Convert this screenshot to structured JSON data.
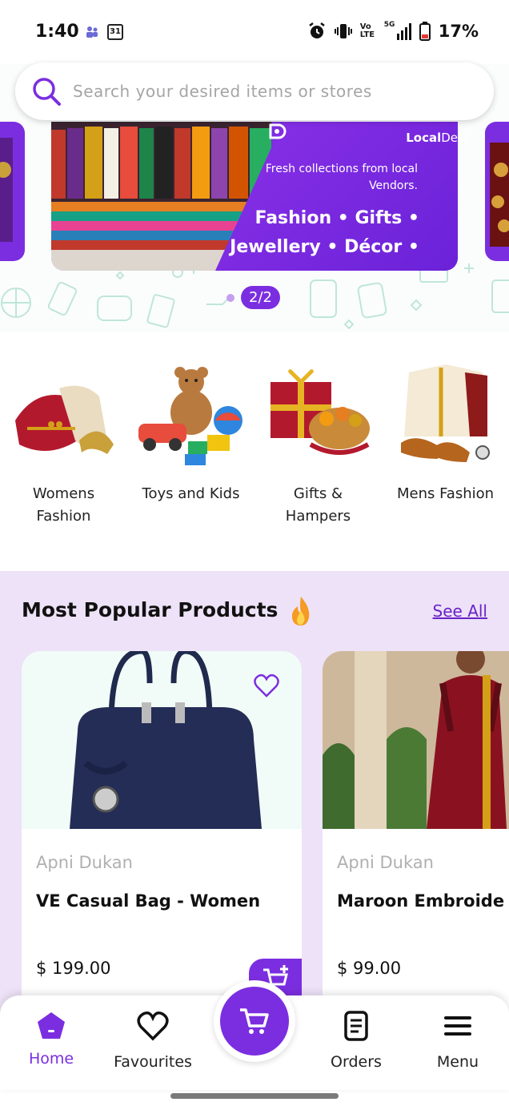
{
  "status_bar": {
    "time": "1:40",
    "calendar_day": "31",
    "battery": "17%",
    "volte": "Vo LTE",
    "network": "5G"
  },
  "search": {
    "placeholder": "Search your desired items or stores"
  },
  "banner": {
    "brand_bold": "Local",
    "brand_thin": "Desi",
    "subtitle": "Fresh collections from local Vendors.",
    "headline": "Fashion • Gifts • Jewellery • Décor •",
    "pager": "2/2"
  },
  "categories": [
    {
      "label": "Womens Fashion"
    },
    {
      "label": "Toys and Kids"
    },
    {
      "label": "Gifts & Hampers"
    },
    {
      "label": "Mens Fashion"
    }
  ],
  "popular": {
    "title": "Most Popular Products",
    "see_all": "See All",
    "products": [
      {
        "vendor": "Apni Dukan",
        "name": "VE Casual Bag - Women",
        "price": "$ 199.00"
      },
      {
        "vendor": "Apni Dukan",
        "name": "Maroon Embroide",
        "price": "$ 99.00"
      }
    ]
  },
  "nav": {
    "home": "Home",
    "favourites": "Favourites",
    "orders": "Orders",
    "menu": "Menu"
  },
  "colors": {
    "accent": "#7b2ee0",
    "popular_bg": "#ede2f7"
  }
}
